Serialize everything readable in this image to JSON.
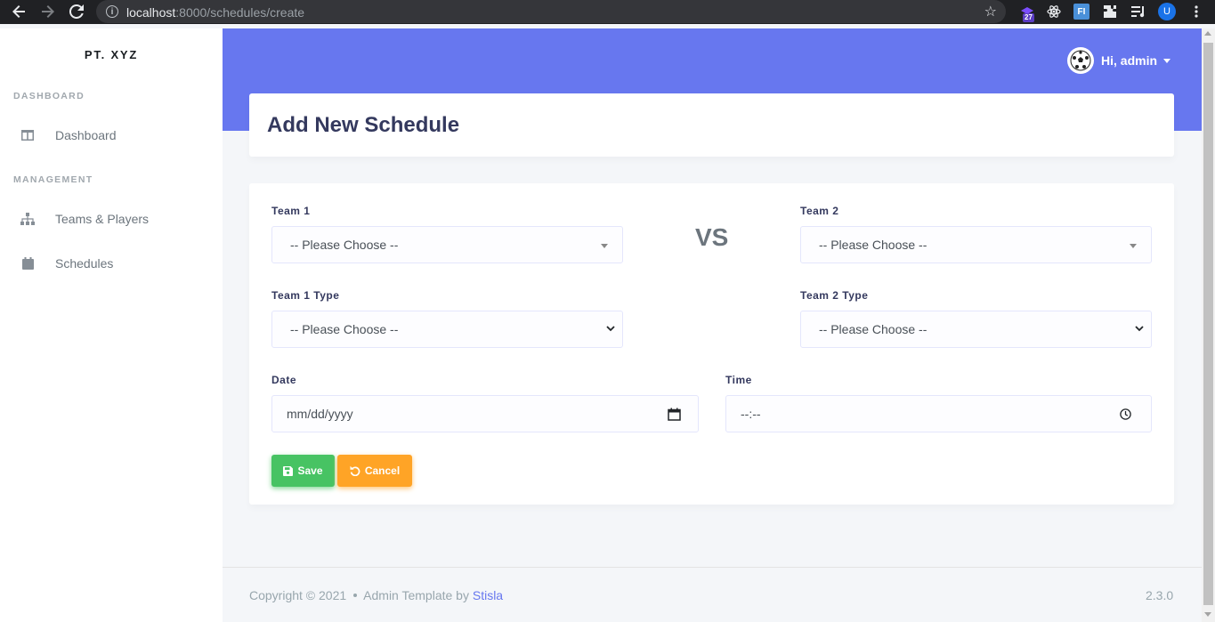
{
  "browser": {
    "url_host": "localhost",
    "url_rest": ":8000/schedules/create",
    "ext_badge": "27",
    "ext_fl": "FI",
    "profile_initial": "U"
  },
  "sidebar": {
    "brand": "PT. XYZ",
    "headers": [
      "DASHBOARD",
      "MANAGEMENT"
    ],
    "items": [
      {
        "label": "Dashboard",
        "icon": "columns-icon"
      },
      {
        "label": "Teams & Players",
        "icon": "sitemap-icon"
      },
      {
        "label": "Schedules",
        "icon": "calendar-icon"
      }
    ]
  },
  "navbar": {
    "user_label": "Hi, admin"
  },
  "page": {
    "title": "Add New Schedule"
  },
  "form": {
    "team1_label": "Team 1",
    "team2_label": "Team 2",
    "vs_text": "VS",
    "team1_value": "-- Please Choose --",
    "team2_value": "-- Please Choose --",
    "team1_type_label": "Team 1 Type",
    "team2_type_label": "Team 2 Type",
    "team1_type_value": "-- Please Choose --",
    "team2_type_value": "-- Please Choose --",
    "date_label": "Date",
    "date_placeholder": "mm/dd/yyyy",
    "time_label": "Time",
    "time_placeholder": "--:--",
    "save_label": "Save",
    "cancel_label": "Cancel"
  },
  "footer": {
    "copyright": "Copyright © 2021",
    "template_text": "Admin Template by",
    "template_link": "Stisla",
    "version": "2.3.0"
  },
  "colors": {
    "primary": "#6777ef",
    "success": "#47c363",
    "warning": "#ffa426"
  }
}
